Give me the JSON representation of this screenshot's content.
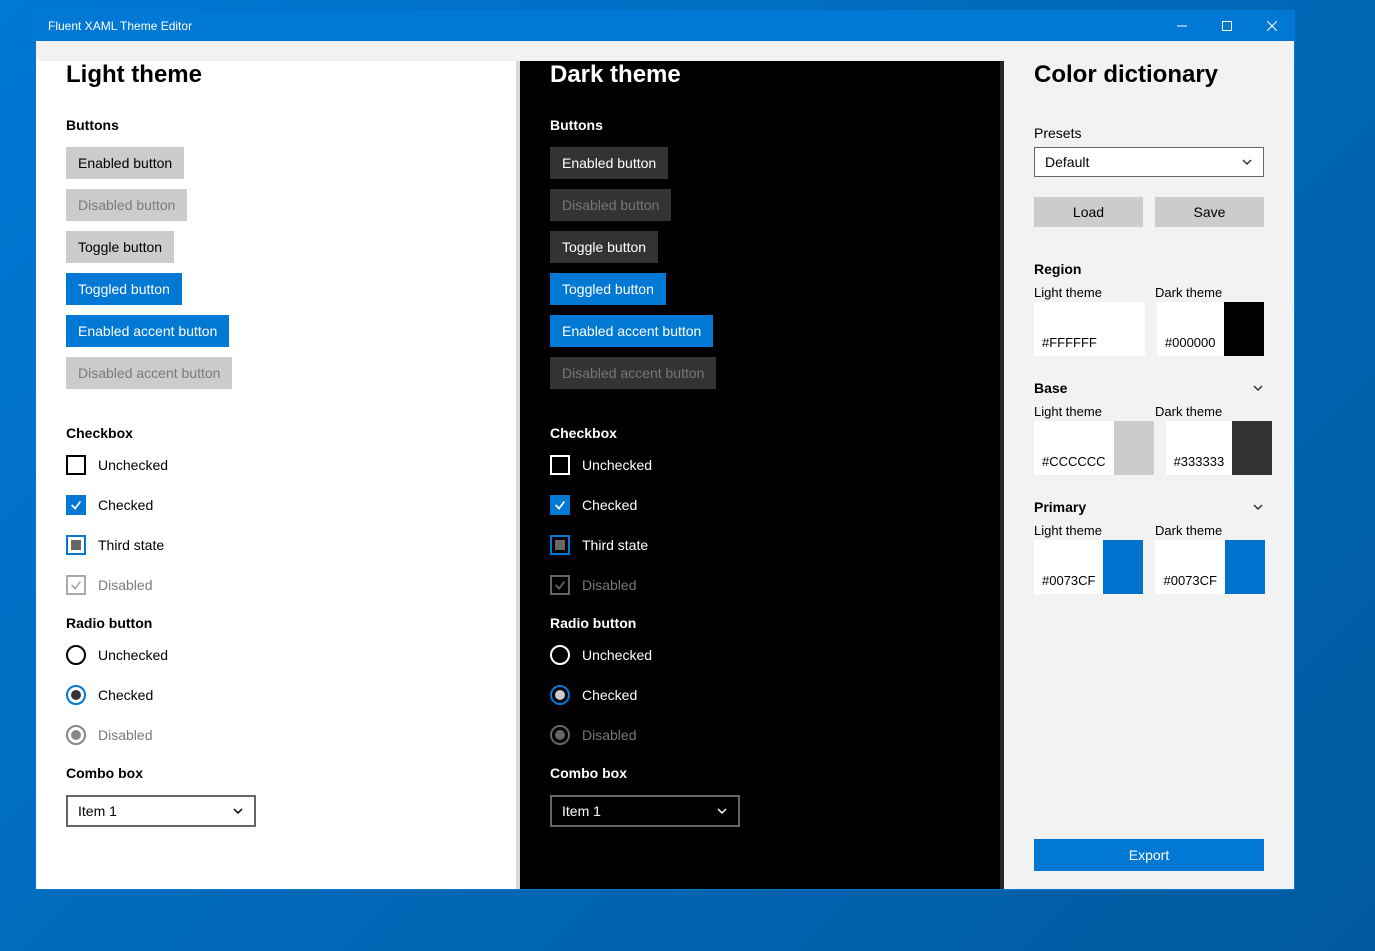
{
  "window": {
    "title": "Fluent XAML Theme Editor"
  },
  "section": {
    "buttons": "Buttons",
    "checkbox": "Checkbox",
    "radio": "Radio button",
    "combo": "Combo box"
  },
  "buttons": {
    "enabled": "Enabled button",
    "disabled": "Disabled button",
    "toggle": "Toggle button",
    "toggled": "Toggled button",
    "accent": "Enabled accent button",
    "accentDisabled": "Disabled accent button"
  },
  "checkbox": {
    "unchecked": "Unchecked",
    "checked": "Checked",
    "third": "Third state",
    "disabled": "Disabled"
  },
  "radio": {
    "unchecked": "Unchecked",
    "checked": "Checked",
    "disabled": "Disabled"
  },
  "combo": {
    "item": "Item 1"
  },
  "light": {
    "title": "Light theme"
  },
  "dark": {
    "title": "Dark theme"
  },
  "cd": {
    "title": "Color dictionary",
    "presetsLabel": "Presets",
    "presetValue": "Default",
    "load": "Load",
    "save": "Save",
    "lightLabel": "Light theme",
    "darkLabel": "Dark theme",
    "region": {
      "name": "Region",
      "light": "#FFFFFF",
      "dark": "#000000"
    },
    "base": {
      "name": "Base",
      "light": "#CCCCCC",
      "dark": "#333333"
    },
    "primary": {
      "name": "Primary",
      "light": "#0073CF",
      "dark": "#0073CF"
    },
    "export": "Export"
  }
}
